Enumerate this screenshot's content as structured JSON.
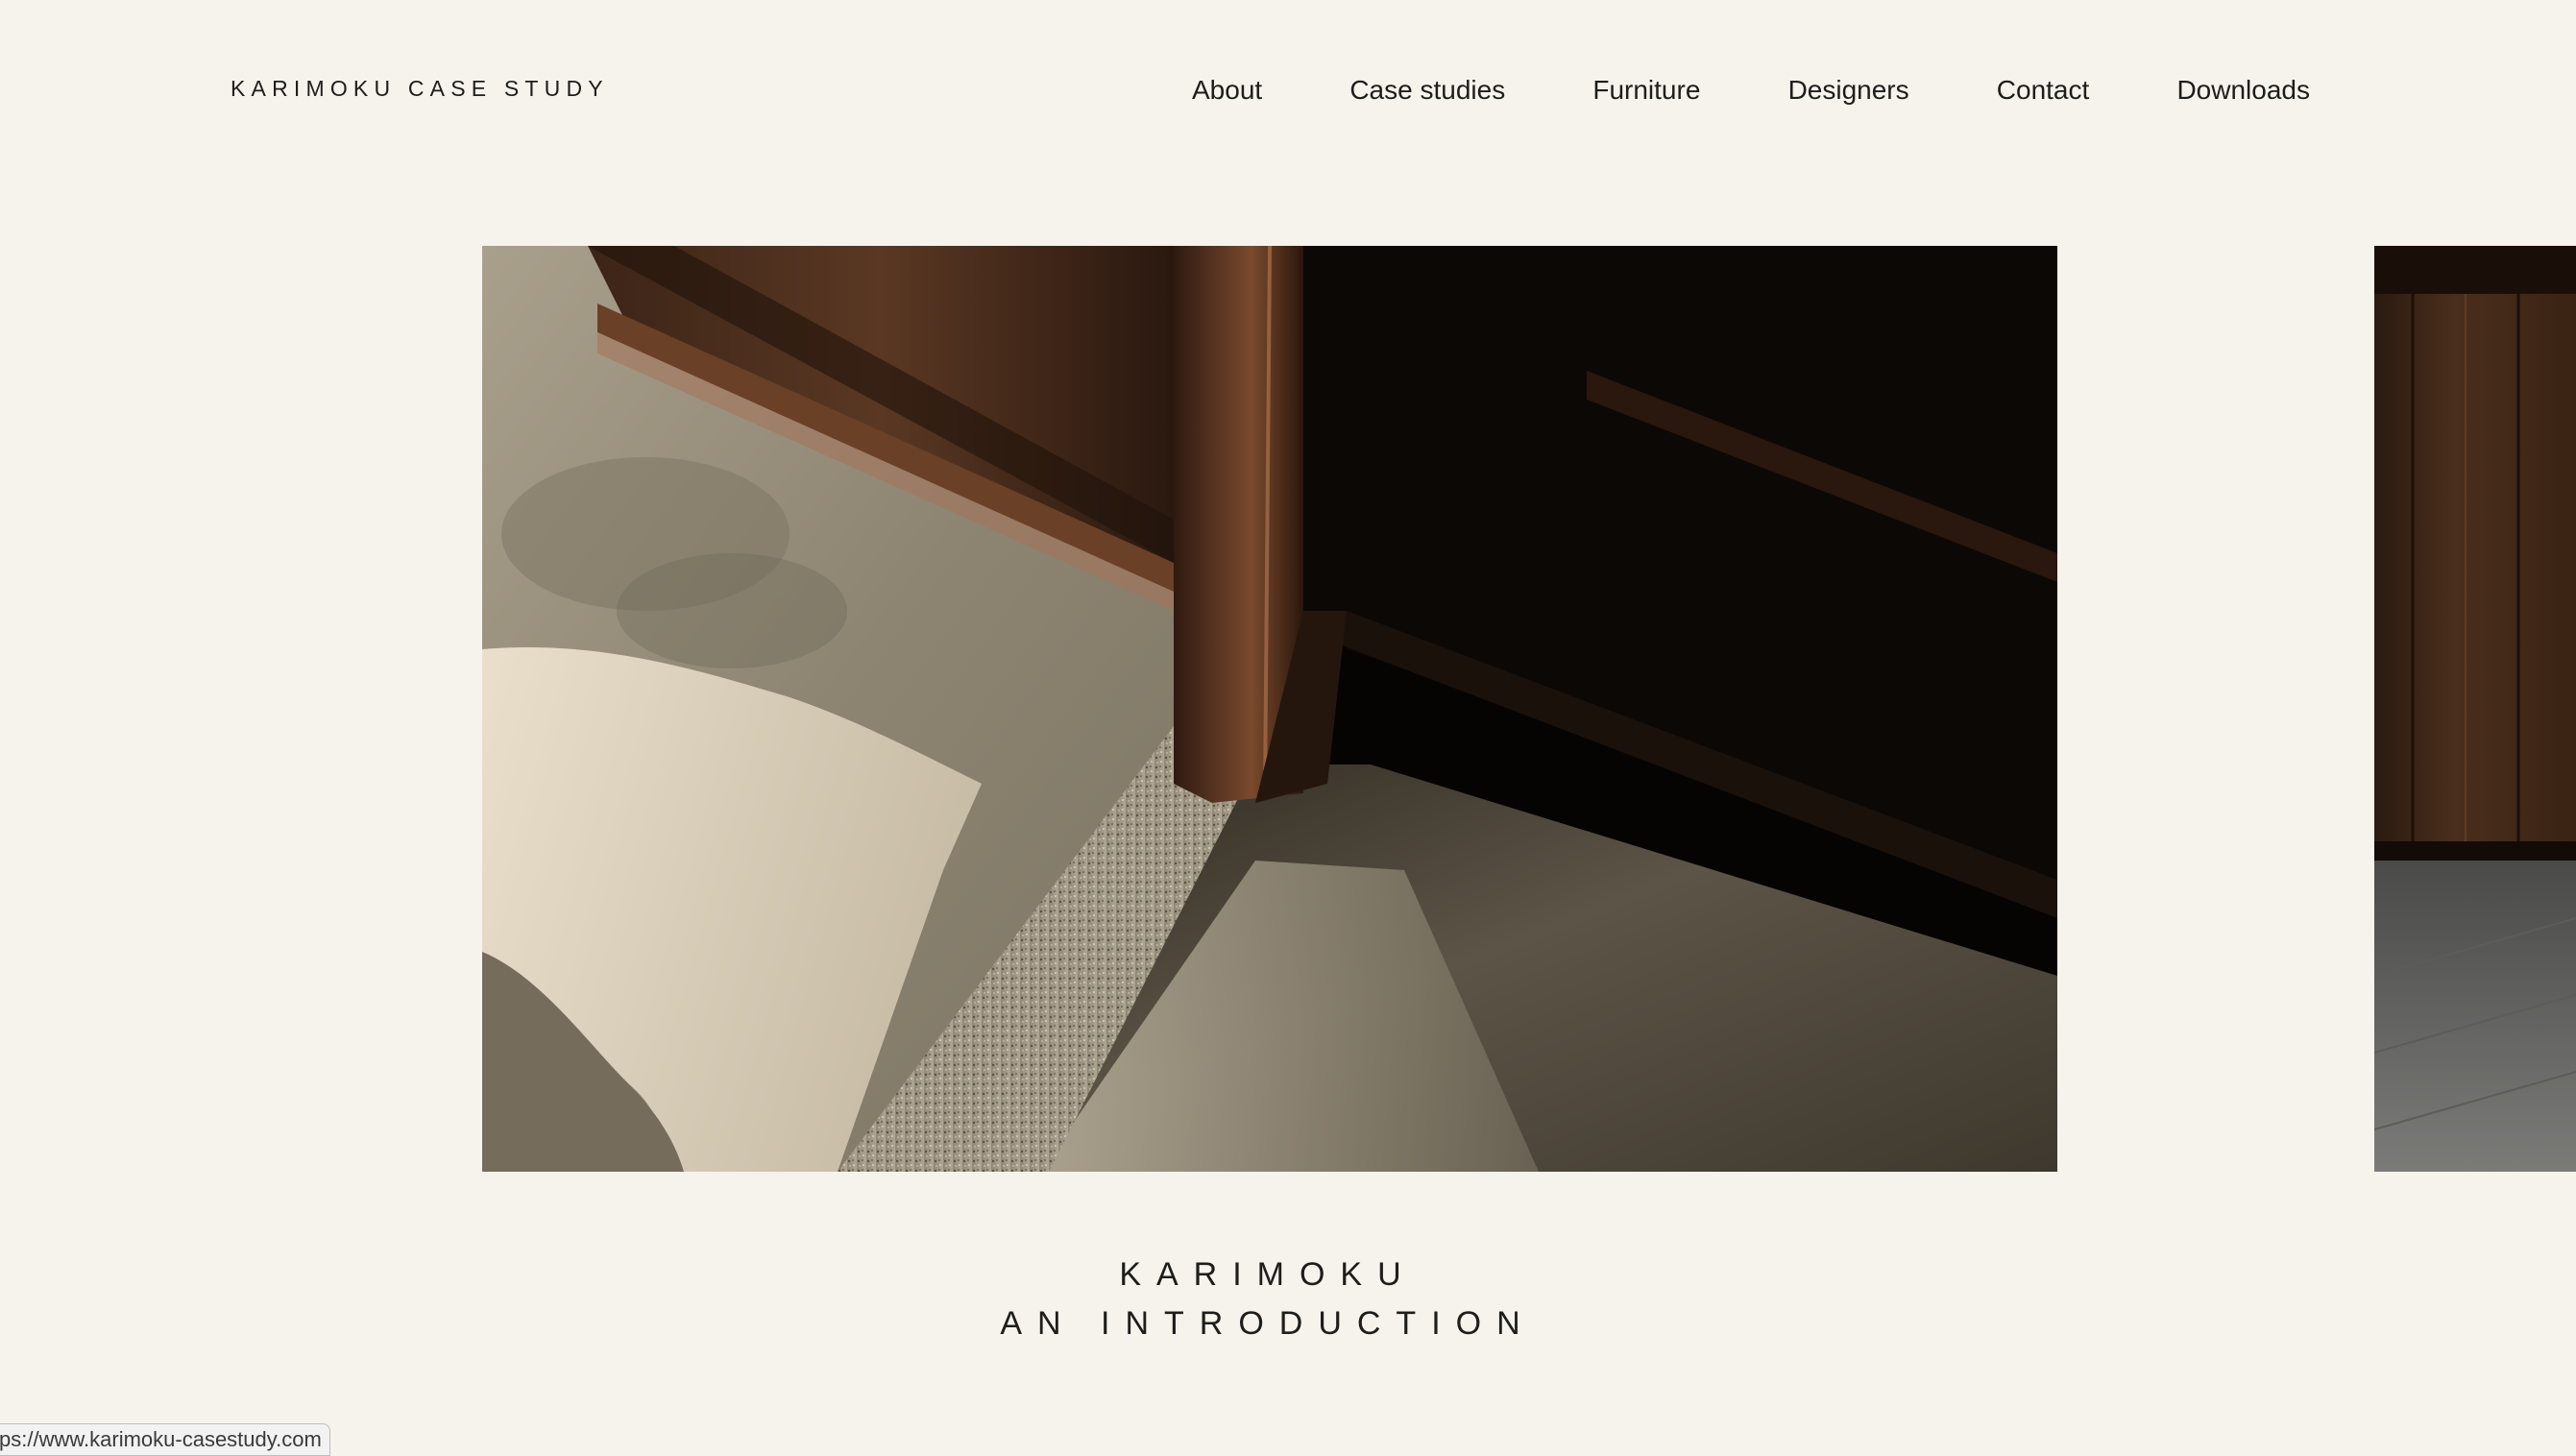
{
  "header": {
    "brand": "KARIMOKU CASE STUDY"
  },
  "nav": {
    "items": [
      {
        "label": "About"
      },
      {
        "label": "Case studies"
      },
      {
        "label": "Furniture"
      },
      {
        "label": "Designers"
      },
      {
        "label": "Contact"
      },
      {
        "label": "Downloads"
      }
    ]
  },
  "carousel": {
    "current": {
      "title_line1": "KARIMOKU",
      "title_line2": "AN INTRODUCTION"
    }
  },
  "status_bar": {
    "url": "ps://www.karimoku-casestudy.com"
  },
  "colors": {
    "background": "#f6f3ed",
    "text": "#1d1d1b"
  }
}
